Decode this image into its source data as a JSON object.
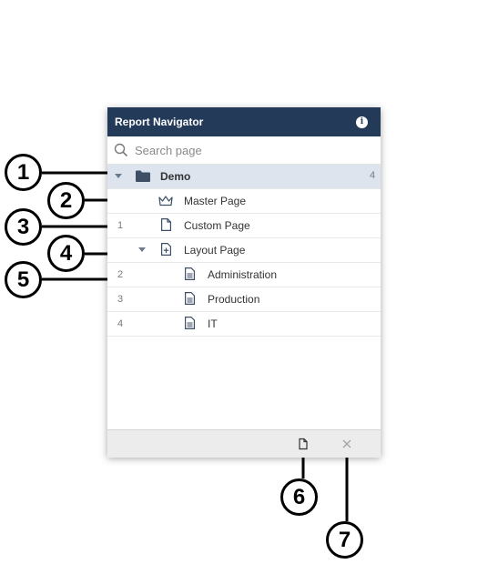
{
  "panel": {
    "title": "Report Navigator",
    "info_icon": "info-icon"
  },
  "search": {
    "placeholder": "Search page"
  },
  "tree": {
    "root": {
      "label": "Demo",
      "count": "4",
      "icon": "folder-icon"
    },
    "master": {
      "label": "Master Page",
      "icon": "crown-icon"
    },
    "custom": {
      "label": "Custom Page",
      "number": "1",
      "icon": "page-icon"
    },
    "layout": {
      "label": "Layout Page",
      "icon": "layout-page-icon"
    },
    "children": [
      {
        "label": "Administration",
        "number": "2",
        "icon": "document-icon"
      },
      {
        "label": "Production",
        "number": "3",
        "icon": "document-icon"
      },
      {
        "label": "IT",
        "number": "4",
        "icon": "document-icon"
      }
    ]
  },
  "footer": {
    "new_page_icon": "new-page-icon",
    "delete_icon": "close-icon"
  },
  "callouts": [
    "1",
    "2",
    "3",
    "4",
    "5",
    "6",
    "7"
  ],
  "colors": {
    "header": "#233a59",
    "selected_row": "#dde4ee",
    "footer": "#ececec"
  }
}
